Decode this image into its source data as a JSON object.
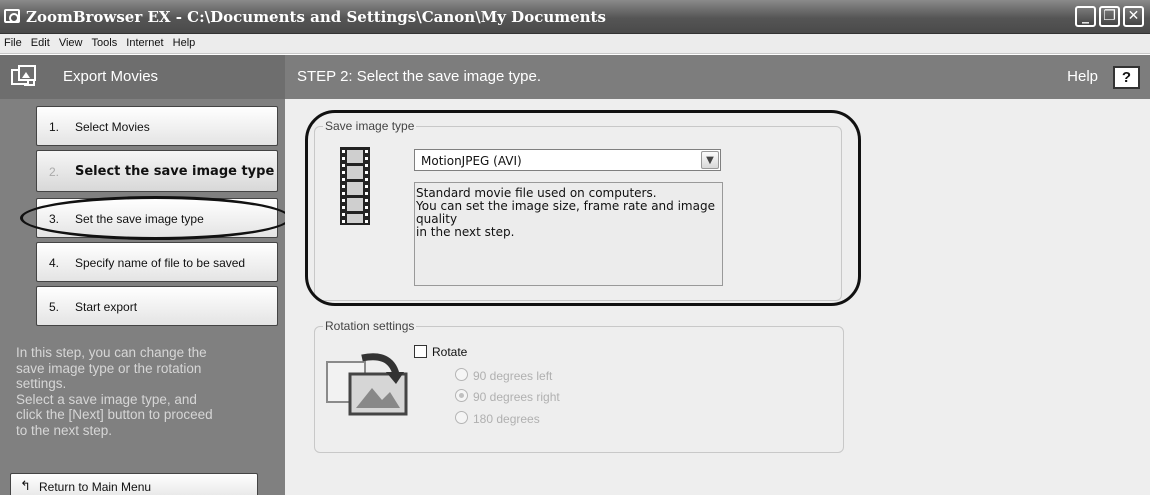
{
  "window": {
    "title": "ZoomBrowser EX  -  C:\\Documents and Settings\\Canon\\My Documents",
    "controls": {
      "minimize": "_",
      "restore": "❐",
      "close": "✕"
    }
  },
  "menu": {
    "items": [
      "File",
      "Edit",
      "View",
      "Tools",
      "Internet",
      "Help"
    ]
  },
  "header": {
    "section": "Export Movies",
    "step_title": "STEP 2: Select the save image type.",
    "help_label": "Help",
    "help_button": "?"
  },
  "sidebar": {
    "steps": [
      {
        "num": "1.",
        "label": "Select Movies"
      },
      {
        "num": "2.",
        "label": "Select the save image type"
      },
      {
        "num": "3.",
        "label": "Set the save image type"
      },
      {
        "num": "4.",
        "label": "Specify name of file to be saved"
      },
      {
        "num": "5.",
        "label": "Start export"
      }
    ],
    "description": "In this step, you can change the\nsave image type or the rotation\nsettings.\n Select a save image type, and\nclick the [Next] button to proceed\nto the next step.",
    "return_label": "Return to Main Menu"
  },
  "save_image": {
    "legend": "Save image type",
    "selected": "MotionJPEG (AVI)",
    "description": "Standard movie file used on computers.\nYou can set the image size, frame rate and image quality\nin the next step."
  },
  "rotation": {
    "legend": "Rotation settings",
    "checkbox_label": "Rotate",
    "options": [
      "90 degrees left",
      "90 degrees right",
      "180 degrees"
    ]
  }
}
